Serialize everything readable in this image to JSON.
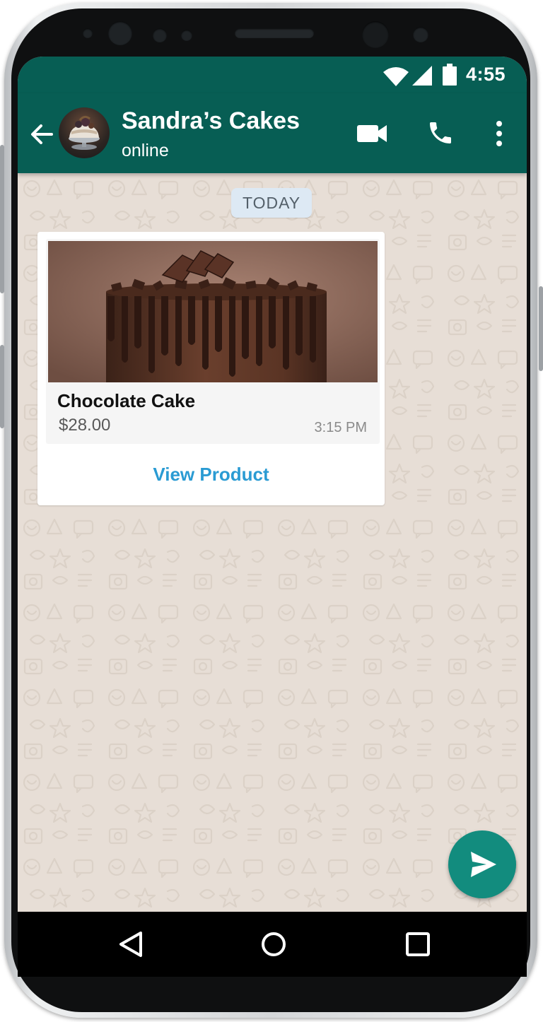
{
  "status_bar": {
    "time": "4:55",
    "icons": [
      "wifi-icon",
      "signal-icon",
      "battery-icon"
    ]
  },
  "header": {
    "contact_name": "Sandra’s Cakes",
    "contact_status": "online",
    "actions": [
      "back-arrow-icon",
      "video-call-icon",
      "phone-icon",
      "more-options-icon"
    ]
  },
  "chat": {
    "date_divider": "TODAY",
    "messages": [
      {
        "type": "product",
        "product_name": "Chocolate Cake",
        "price": "$28.00",
        "time": "3:15 PM",
        "action_label": "View Product"
      }
    ]
  },
  "composer": {
    "send_icon": "send-icon"
  },
  "nav_bar": {
    "buttons": [
      "back-triangle-icon",
      "home-circle-icon",
      "recents-square-icon"
    ]
  },
  "colors": {
    "header": "#075e54",
    "accent": "#128c7e",
    "link": "#2a9bd3",
    "chat_background": "#e7ded6",
    "date_chip": "#dde9f4"
  }
}
